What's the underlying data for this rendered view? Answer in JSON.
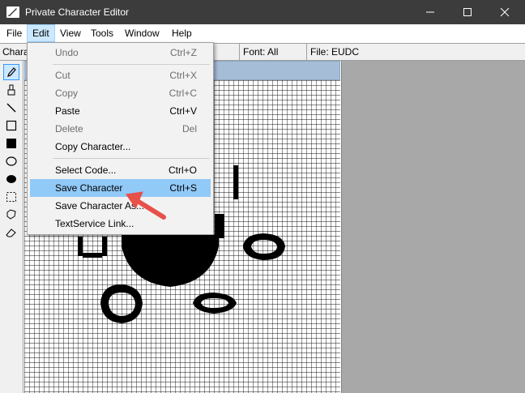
{
  "window": {
    "title": "Private Character Editor"
  },
  "menubar": {
    "items": [
      "File",
      "Edit",
      "View",
      "Tools",
      "Window",
      "Help"
    ],
    "active": "Edit"
  },
  "infobar": {
    "character_label": "Chara",
    "font_label": "Font: All",
    "file_label": "File: EUDC"
  },
  "toolbar": {
    "tools": [
      {
        "name": "pencil-icon",
        "selected": true
      },
      {
        "name": "brush-icon"
      },
      {
        "name": "line-icon"
      },
      {
        "name": "hollow-rectangle-icon"
      },
      {
        "name": "filled-rectangle-icon"
      },
      {
        "name": "hollow-ellipse-icon"
      },
      {
        "name": "filled-ellipse-icon"
      },
      {
        "name": "rectangular-selection-icon"
      },
      {
        "name": "freeform-selection-icon"
      },
      {
        "name": "eraser-icon"
      }
    ]
  },
  "edit_menu": {
    "undo": {
      "label": "Undo",
      "shortcut": "Ctrl+Z"
    },
    "cut": {
      "label": "Cut",
      "shortcut": "Ctrl+X"
    },
    "copy": {
      "label": "Copy",
      "shortcut": "Ctrl+C"
    },
    "paste": {
      "label": "Paste",
      "shortcut": "Ctrl+V"
    },
    "delete": {
      "label": "Delete",
      "shortcut": "Del"
    },
    "copy_character": {
      "label": "Copy Character..."
    },
    "select_code": {
      "label": "Select Code...",
      "shortcut": "Ctrl+O"
    },
    "save_character": {
      "label": "Save Character",
      "shortcut": "Ctrl+S"
    },
    "save_character_as": {
      "label": "Save Character As..."
    },
    "textservice_link": {
      "label": "TextService Link..."
    }
  },
  "colors": {
    "highlight": "#91c9f7",
    "arrow": "#e8504a",
    "titlebar": "#3c3c3c"
  }
}
